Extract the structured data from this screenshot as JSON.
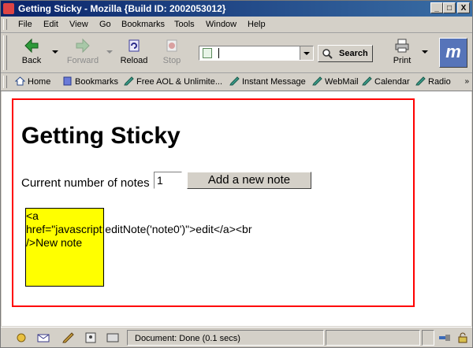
{
  "window": {
    "title": "Getting Sticky - Mozilla {Build ID: 2002053012}",
    "min": "_",
    "max": "□",
    "close": "X"
  },
  "menu": [
    "File",
    "Edit",
    "View",
    "Go",
    "Bookmarks",
    "Tools",
    "Window",
    "Help"
  ],
  "nav": {
    "back": "Back",
    "forward": "Forward",
    "reload": "Reload",
    "stop": "Stop",
    "search": "Search",
    "print": "Print",
    "logo": "m"
  },
  "personal_bar": [
    "Home",
    "Bookmarks",
    "Free AOL & Unlimite...",
    "Instant Message",
    "WebMail",
    "Calendar",
    "Radio"
  ],
  "page": {
    "heading": "Getting Sticky",
    "count_label": "Current number of notes",
    "count_value": "1",
    "add_button": "Add a new note",
    "note_text": "<a\nhref=\"javascript:editNote('note0')\">edit</a><br\n/>New note"
  },
  "status": {
    "text": "Document: Done (0.1 secs)"
  },
  "colors": {
    "title_bar": "#0a246a",
    "note_bg": "#ffff00",
    "border_red": "#ff0000"
  }
}
